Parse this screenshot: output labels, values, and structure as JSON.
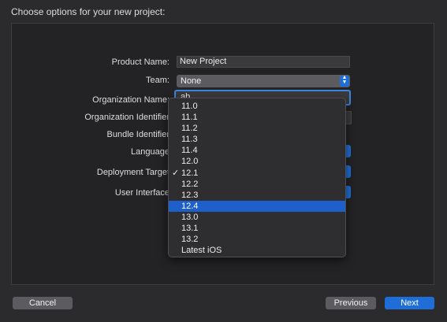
{
  "header": {
    "title": "Choose options for your new project:"
  },
  "form": {
    "product_name_label": "Product Name:",
    "product_name_value": "New Project",
    "team_label": "Team:",
    "team_value": "None",
    "org_name_label": "Organization Name:",
    "org_name_value": "ab",
    "org_identifier_label": "Organization Identifier",
    "bundle_identifier_label": "Bundle Identifier",
    "language_label": "Language",
    "deployment_target_label": "Deployment Target",
    "user_interface_label": "User Interface"
  },
  "deployment_menu": {
    "items": [
      "11.0",
      "11.1",
      "11.2",
      "11.3",
      "11.4",
      "12.0",
      "12.1",
      "12.2",
      "12.3",
      "12.4",
      "13.0",
      "13.1",
      "13.2",
      "Latest iOS"
    ],
    "checked": "12.1",
    "highlighted": "12.4",
    "check_mark": "✓"
  },
  "footer": {
    "cancel": "Cancel",
    "previous": "Previous",
    "next": "Next"
  },
  "colors": {
    "accent": "#1f6ed8",
    "highlight": "#1f5fc9",
    "background": "#2b2b2d"
  }
}
